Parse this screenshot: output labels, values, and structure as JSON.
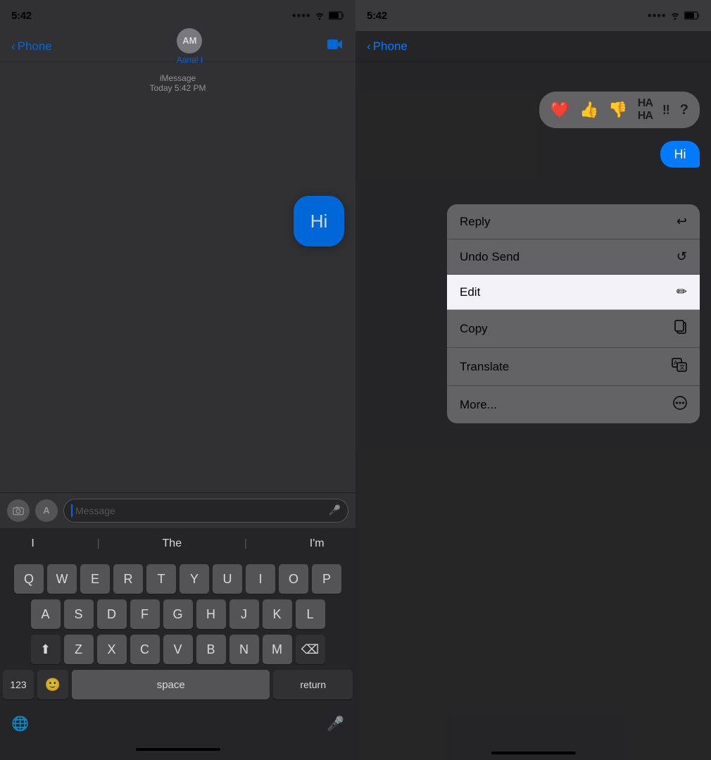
{
  "left": {
    "status_time": "5:42",
    "nav_back": "Phone",
    "nav_avatar_initials": "AM",
    "nav_name": "Aanal I",
    "imessage_label": "iMessage",
    "imessage_time": "Today 5:42 PM",
    "hi_text": "Hi",
    "input_placeholder": "Message",
    "predictive": [
      "I",
      "The",
      "I'm"
    ],
    "keys_row1": [
      "Q",
      "W",
      "E",
      "R",
      "T",
      "Y",
      "U",
      "I",
      "O",
      "P"
    ],
    "keys_row2": [
      "A",
      "S",
      "D",
      "F",
      "G",
      "H",
      "J",
      "K",
      "L"
    ],
    "keys_row3": [
      "Z",
      "X",
      "C",
      "V",
      "B",
      "N",
      "M"
    ],
    "key_123": "123",
    "key_space": "space",
    "key_return": "return"
  },
  "right": {
    "status_time": "5:42",
    "nav_back": "Phone",
    "hi_text": "Hi",
    "reactions": [
      "❤️",
      "👍",
      "👎",
      "😄",
      "‼️",
      "?"
    ],
    "context_menu": [
      {
        "label": "Reply",
        "icon": "↩"
      },
      {
        "label": "Undo Send",
        "icon": "↺"
      },
      {
        "label": "Edit",
        "icon": "✏️",
        "active": true
      },
      {
        "label": "Copy",
        "icon": "📋"
      },
      {
        "label": "Translate",
        "icon": "🔤"
      },
      {
        "label": "More...",
        "icon": "⊕"
      }
    ]
  }
}
